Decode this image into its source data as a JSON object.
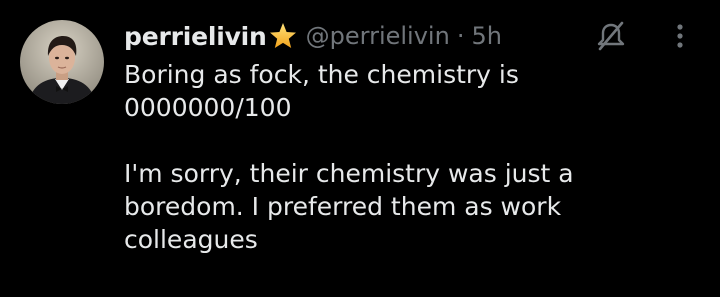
{
  "tweet": {
    "display_name": "perrielivin",
    "badge_icon": "star-badge-icon",
    "handle": "@perrielivin",
    "separator": "·",
    "time": "5h",
    "avatar_icon": "profile-photo",
    "mute_icon": "muted-notifications-icon",
    "more_icon": "more-options-icon",
    "paragraph_1_line_1": "Boring as fock, the chemistry is",
    "paragraph_1_line_2": "0000000/100",
    "paragraph_2_line_1": "I'm sorry, their chemistry was just a",
    "paragraph_2_line_2": "boredom. I preferred them as work",
    "paragraph_2_line_3": "colleagues"
  },
  "colors": {
    "background": "#000000",
    "primary_text": "#e7e9ea",
    "secondary_text": "#71767b",
    "badge": "#f5c518"
  }
}
